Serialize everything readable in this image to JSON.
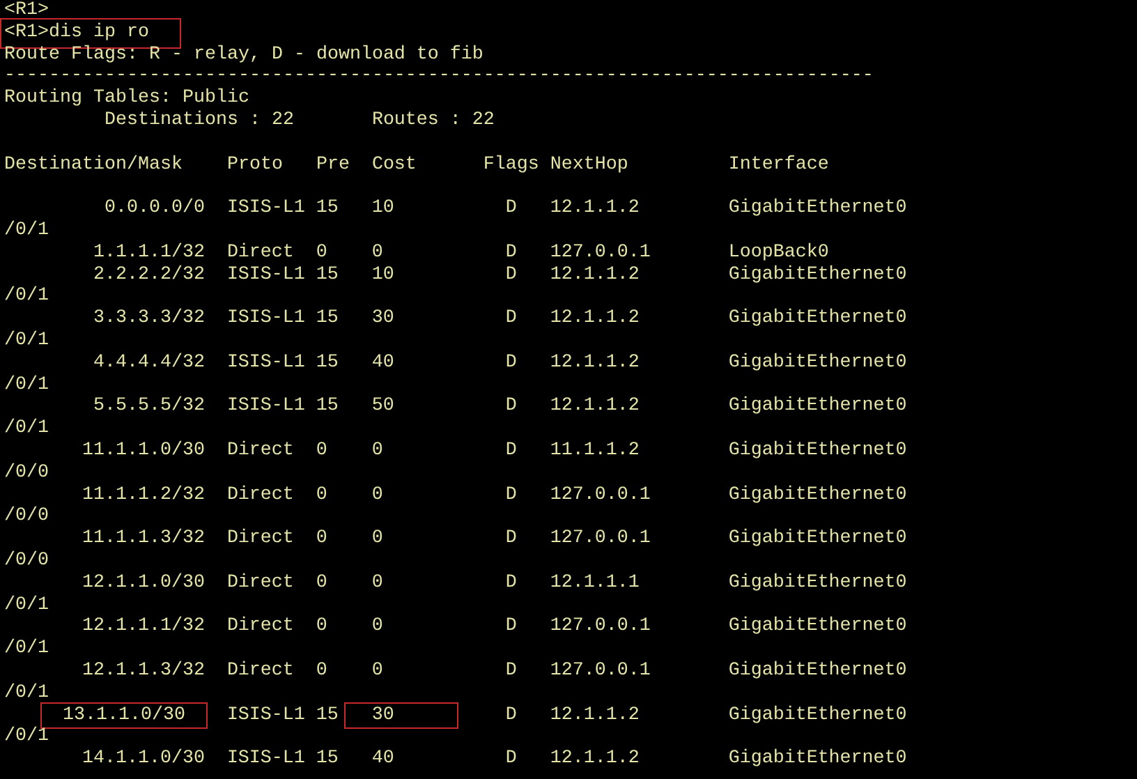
{
  "terminal": {
    "lines": [
      {
        "kind": "text",
        "text": "<R1>",
        "boxed": false
      },
      {
        "kind": "text",
        "text": "<R1>dis ip ro",
        "boxed": true
      },
      {
        "kind": "text",
        "text": "Route Flags: R - relay, D - download to fib",
        "boxed": false
      },
      {
        "kind": "text",
        "text": "------------------------------------------------------------------------------",
        "boxed": false
      },
      {
        "kind": "text",
        "text": "Routing Tables: Public",
        "boxed": false
      },
      {
        "kind": "text",
        "text": "         Destinations : 22       Routes : 22",
        "boxed": false
      },
      {
        "kind": "blank"
      },
      {
        "kind": "text",
        "text": "Destination/Mask    Proto   Pre  Cost      Flags NextHop         Interface",
        "boxed": false
      },
      {
        "kind": "blank"
      },
      {
        "kind": "route",
        "destination": "0.0.0.0/0",
        "proto": "ISIS-L1",
        "pre": "15",
        "cost": "10",
        "flags": "D",
        "nexthop": "12.1.1.2",
        "interface": "GigabitEthernet0",
        "interface_wrap": "/0/1",
        "destination_boxed": false,
        "cost_boxed": false
      },
      {
        "kind": "route",
        "destination": "1.1.1.1/32",
        "proto": "Direct",
        "pre": "0",
        "cost": "0",
        "flags": "D",
        "nexthop": "127.0.0.1",
        "interface": "LoopBack0",
        "destination_boxed": false,
        "cost_boxed": false
      },
      {
        "kind": "route",
        "destination": "2.2.2.2/32",
        "proto": "ISIS-L1",
        "pre": "15",
        "cost": "10",
        "flags": "D",
        "nexthop": "12.1.1.2",
        "interface": "GigabitEthernet0",
        "interface_wrap": "/0/1",
        "destination_boxed": false,
        "cost_boxed": false
      },
      {
        "kind": "route",
        "destination": "3.3.3.3/32",
        "proto": "ISIS-L1",
        "pre": "15",
        "cost": "30",
        "flags": "D",
        "nexthop": "12.1.1.2",
        "interface": "GigabitEthernet0",
        "interface_wrap": "/0/1",
        "destination_boxed": false,
        "cost_boxed": false
      },
      {
        "kind": "route",
        "destination": "4.4.4.4/32",
        "proto": "ISIS-L1",
        "pre": "15",
        "cost": "40",
        "flags": "D",
        "nexthop": "12.1.1.2",
        "interface": "GigabitEthernet0",
        "interface_wrap": "/0/1",
        "destination_boxed": false,
        "cost_boxed": false
      },
      {
        "kind": "route",
        "destination": "5.5.5.5/32",
        "proto": "ISIS-L1",
        "pre": "15",
        "cost": "50",
        "flags": "D",
        "nexthop": "12.1.1.2",
        "interface": "GigabitEthernet0",
        "interface_wrap": "/0/1",
        "destination_boxed": false,
        "cost_boxed": false
      },
      {
        "kind": "route",
        "destination": "11.1.1.0/30",
        "proto": "Direct",
        "pre": "0",
        "cost": "0",
        "flags": "D",
        "nexthop": "11.1.1.2",
        "interface": "GigabitEthernet0",
        "interface_wrap": "/0/0",
        "destination_boxed": false,
        "cost_boxed": false
      },
      {
        "kind": "route",
        "destination": "11.1.1.2/32",
        "proto": "Direct",
        "pre": "0",
        "cost": "0",
        "flags": "D",
        "nexthop": "127.0.0.1",
        "interface": "GigabitEthernet0",
        "interface_wrap": "/0/0",
        "destination_boxed": false,
        "cost_boxed": false
      },
      {
        "kind": "route",
        "destination": "11.1.1.3/32",
        "proto": "Direct",
        "pre": "0",
        "cost": "0",
        "flags": "D",
        "nexthop": "127.0.0.1",
        "interface": "GigabitEthernet0",
        "interface_wrap": "/0/0",
        "destination_boxed": false,
        "cost_boxed": false
      },
      {
        "kind": "route",
        "destination": "12.1.1.0/30",
        "proto": "Direct",
        "pre": "0",
        "cost": "0",
        "flags": "D",
        "nexthop": "12.1.1.1",
        "interface": "GigabitEthernet0",
        "interface_wrap": "/0/1",
        "destination_boxed": false,
        "cost_boxed": false
      },
      {
        "kind": "route",
        "destination": "12.1.1.1/32",
        "proto": "Direct",
        "pre": "0",
        "cost": "0",
        "flags": "D",
        "nexthop": "127.0.0.1",
        "interface": "GigabitEthernet0",
        "interface_wrap": "/0/1",
        "destination_boxed": false,
        "cost_boxed": false
      },
      {
        "kind": "route",
        "destination": "12.1.1.3/32",
        "proto": "Direct",
        "pre": "0",
        "cost": "0",
        "flags": "D",
        "nexthop": "127.0.0.1",
        "interface": "GigabitEthernet0",
        "interface_wrap": "/0/1",
        "destination_boxed": false,
        "cost_boxed": false
      },
      {
        "kind": "route",
        "destination": "13.1.1.0/30",
        "proto": "ISIS-L1",
        "pre": "15",
        "cost": "30",
        "flags": "D",
        "nexthop": "12.1.1.2",
        "interface": "GigabitEthernet0",
        "interface_wrap": "/0/1",
        "destination_boxed": true,
        "cost_boxed": true
      },
      {
        "kind": "route",
        "destination": "14.1.1.0/30",
        "proto": "ISIS-L1",
        "pre": "15",
        "cost": "40",
        "flags": "D",
        "nexthop": "12.1.1.2",
        "interface": "GigabitEthernet0",
        "destination_boxed": false,
        "cost_boxed": false
      }
    ]
  }
}
